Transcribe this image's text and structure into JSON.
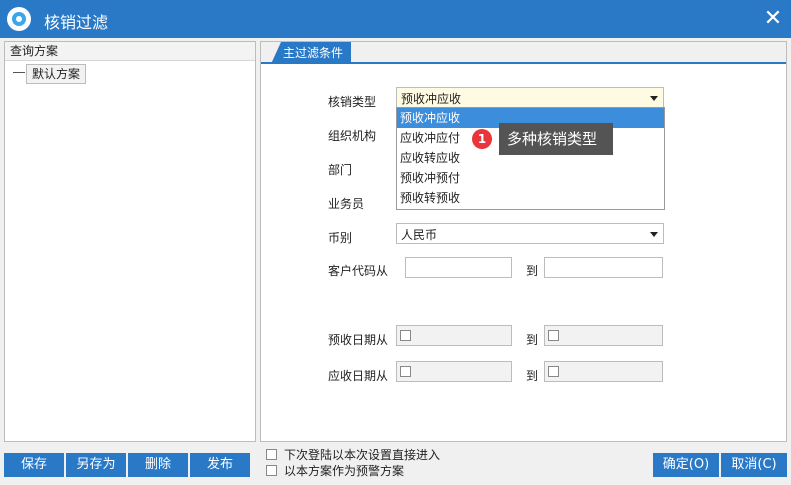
{
  "window": {
    "title": "核销过滤",
    "close_glyph": "✕"
  },
  "left": {
    "header": "查询方案",
    "tree_item": "默认方案"
  },
  "tabs": [
    {
      "label": "主过滤条件"
    }
  ],
  "form": {
    "type_label": "核销类型",
    "type_value": "预收冲应收",
    "org_label": "组织机构",
    "dept_label": "部门",
    "staff_label": "业务员",
    "currency_label": "币别",
    "currency_value": "人民币",
    "customer_from_label": "客户代码从",
    "customer_to_label": "到",
    "prepaid_date_from_label": "预收日期从",
    "prepaid_date_to_label": "到",
    "receivable_date_from_label": "应收日期从",
    "receivable_date_to_label": "到"
  },
  "dropdown": {
    "options": [
      "预收冲应收",
      "应收冲应付",
      "应收转应收",
      "预收冲预付",
      "预收转预收"
    ],
    "selected_index": 0
  },
  "annotation": {
    "badge": "1",
    "text": "多种核销类型"
  },
  "buttons": {
    "save": "保存",
    "save_as": "另存为",
    "delete": "删除",
    "publish": "发布",
    "ok": "确定(O)",
    "cancel": "取消(C)"
  },
  "checkboxes": {
    "direct_enter": "下次登陆以本次设置直接进入",
    "warning_plan": "以本方案作为预警方案"
  },
  "colors": {
    "accent": "#2a79c7",
    "selected_option": "#3c8ddc",
    "badge": "#e8343a",
    "tooltip": "#545454"
  }
}
